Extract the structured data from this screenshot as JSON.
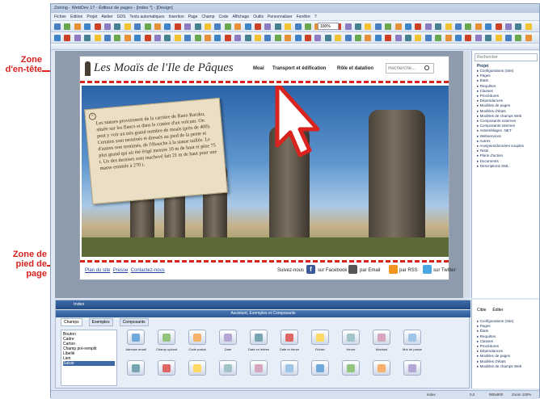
{
  "annotations": {
    "header_zone": "Zone\nd'en-tête",
    "footer_zone": "Zone de\npied de\npage"
  },
  "window": {
    "title": "Zoning - WebDev 17 - Éditeur de pages - [index *] - [Design]"
  },
  "menu": [
    "Fichier",
    "Edition",
    "Projet",
    "Atelier",
    "GDS",
    "Tests automatiques",
    "Insertion",
    "Page",
    "Champ",
    "Code",
    "Affichage",
    "Outils",
    "Personnaliser",
    "Fenêtre",
    "?"
  ],
  "toolbar": {
    "zoom": "100%"
  },
  "site": {
    "logo": "Les Moaïs de l'Ile de Pâques",
    "nav": [
      "Moaï",
      "Transport et édification",
      "Rôle et datation"
    ],
    "search_placeholder": "Recherche...",
    "text": "Les statues proviennent de la carrière de Rano Raraku, située sur les flancs et dans le cratère d'un volcain. On peut y voir un très grand nombre de moaïs (près de 400). Certains sont terminés et dressés au pied de la pente et d'autres non terminés, de l'ébauche à la statue taillée. Le plus grand qui ait été érigé mesure 10 m de haut et pèse 75 t. Un des derniers sont inachevé fait 21 m de haut pour une masse estimée à 270 t.",
    "footer_links": [
      "Plan du site",
      "Presse",
      "Contactez-nous"
    ],
    "follow_label": "Suivez-nous",
    "social": [
      "sur Facebook",
      "par Email",
      "par RSS",
      "sur Twitter"
    ]
  },
  "project_explorer": {
    "search_placeholder": "Rechercher",
    "root": "Projet",
    "items": [
      "Configurations (Site)",
      "Pages",
      "États",
      "Requêtes",
      "Classes",
      "Procédures",
      "Dépendances",
      "Modèles de pages",
      "Modèles d'états",
      "Modèles de champs Web",
      "Composants externes",
      "Composants internes",
      "Assemblages .NET",
      "Webservices",
      "Autres",
      "Analyses/données souples",
      "Tests",
      "Plans d'action",
      "Documents",
      "Descriptions XML"
    ]
  },
  "bottom_panel": {
    "tab": "Index",
    "title": "Assistant, Exemples et Composants",
    "tabs": [
      "Champs",
      "Exemples",
      "Composants"
    ],
    "categories": [
      "Bouton",
      "Cadre",
      "Carton",
      "Champ pré-remplit",
      "Libellé",
      "Lien",
      "Saisie"
    ],
    "selected_category": "Saisie",
    "controls": [
      "Adresse email",
      "Champ upload",
      "Code postal",
      "Date",
      "Date en lettres",
      "Date et heure",
      "Fichier",
      "Heure",
      "Montant",
      "Mot de passe"
    ]
  },
  "right_bottom": {
    "tabs": [
      "Cible",
      "Éditer"
    ],
    "items": [
      "Configurations (Site)",
      "Pages",
      "États",
      "Requêtes",
      "Classes",
      "Procédures",
      "Dépendances",
      "Modèles de pages",
      "Modèles d'états",
      "Modèles de champs Web"
    ]
  },
  "status": {
    "left": "index",
    "pos": "0,0",
    "size": "980x800",
    "zoom": "Zoom 100%"
  }
}
